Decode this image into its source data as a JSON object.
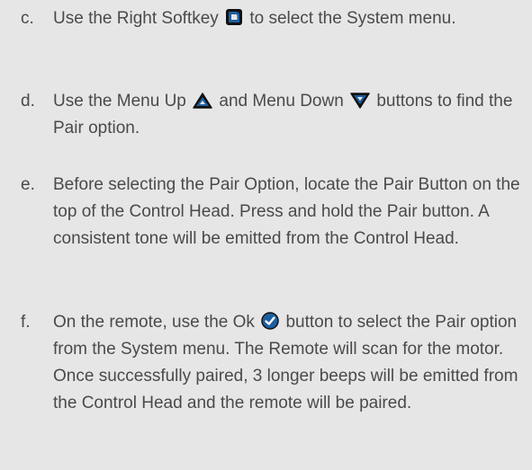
{
  "steps": [
    {
      "letter": "c.",
      "before": "Use the Right Softkey",
      "icon": "right-softkey-icon",
      "after": "to select the System menu."
    },
    {
      "letter": "d.",
      "before": "Use the Menu Up",
      "icon": "menu-up-icon",
      "middle": "and Menu Down",
      "icon2": "menu-down-icon",
      "after": "buttons to find the Pair option."
    },
    {
      "letter": "e.",
      "text": "Before selecting the Pair Option, locate the Pair Button on the top of the Control Head. Press and hold the Pair button.  A consistent tone will be emitted from the Control Head."
    },
    {
      "letter": "f.",
      "before": "On the remote, use the Ok",
      "icon": "ok-check-icon",
      "after": "button to select the Pair option from the System menu.  The Remote will scan for the motor.  Once successfully paired, 3 longer beeps will be emitted from the Control Head and the remote will be paired."
    }
  ],
  "colors": {
    "background": "#e6e6e6",
    "text": "#4a4a4a",
    "icon_fill": "#1d5fa0",
    "icon_outline": "#111111"
  }
}
